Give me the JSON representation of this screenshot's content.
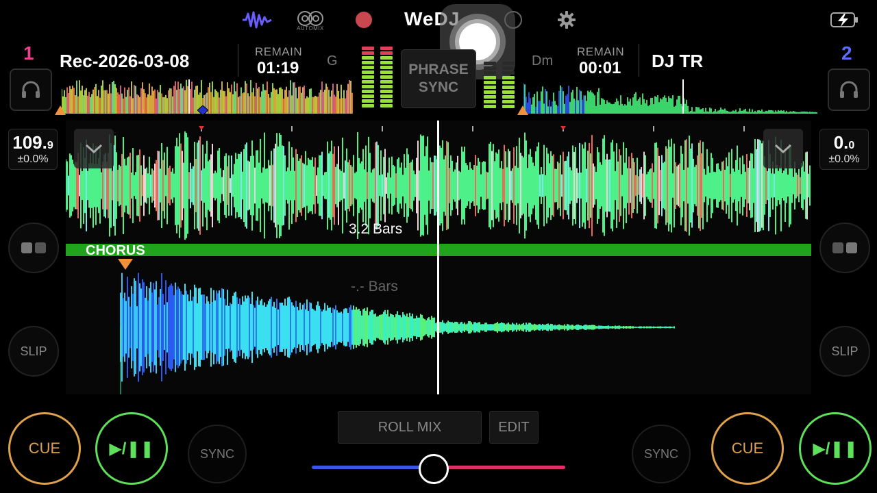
{
  "toolbar": {
    "logo": "WeDJ",
    "automix_label": "AUTOMIX",
    "colors": {
      "waveform_icon": "#6b5cff",
      "record": "#c9474e"
    }
  },
  "deck1": {
    "number": "1",
    "number_color": "#e8438a",
    "title": "Rec-2026-03-08",
    "remain_label": "REMAIN",
    "remain_time": "01:19",
    "key": "G",
    "bpm_int": "109.",
    "bpm_dec": "9",
    "pitch": "±0.0%",
    "slip": "SLIP",
    "cue": "CUE",
    "play": "▶/❚❚",
    "sync": "SYNC"
  },
  "deck2": {
    "number": "2",
    "number_color": "#5b6cff",
    "title": "DJ TR",
    "remain_label": "REMAIN",
    "remain_time": "00:01",
    "key": "Dm",
    "bpm_int": "0.",
    "bpm_dec": "0",
    "pitch": "±0.0%",
    "slip": "SLIP",
    "cue": "CUE",
    "play": "▶/❚❚",
    "sync": "SYNC"
  },
  "center": {
    "phrase_sync_line1": "PHRASE",
    "phrase_sync_line2": "SYNC",
    "roll_mix": "ROLL MIX",
    "edit": "EDIT"
  },
  "waveform": {
    "phrase_label": "CHORUS",
    "bars_upper": "3.2 Bars",
    "bars_lower": "-.- Bars"
  },
  "crossfader": {
    "position": 0.48
  }
}
